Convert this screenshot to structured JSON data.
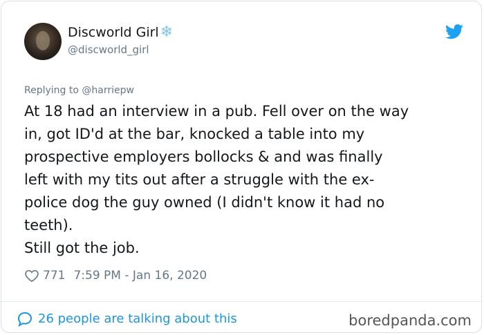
{
  "author": {
    "display_name": "Discworld Girl",
    "name_emoji": "❄",
    "handle": "@discworld_girl"
  },
  "icons": {
    "avatar": "profile-photo",
    "logo": "twitter-bird-icon",
    "like": "heart-icon",
    "conversation": "speech-bubble-icon"
  },
  "colors": {
    "twitter_blue": "#1da1f2",
    "link_blue": "#1b95e0",
    "secondary_text": "#657786"
  },
  "tweet": {
    "replying_to": "Replying to @harriepw",
    "lines": [
      "At 18 had an interview in a pub. Fell over on the way",
      "in, got ID'd at the bar, knocked a table into my",
      "prospective employers bollocks & and was finally",
      "left with my tits out after a struggle with the ex-",
      "police dog the guy owned (I didn't know it had no",
      "teeth).",
      "Still got the job."
    ],
    "likes": "771",
    "timestamp": "7:59 PM - Jan 16, 2020"
  },
  "footer": {
    "conversation_label": "26 people are talking about this"
  },
  "watermark": "boredpanda.com"
}
